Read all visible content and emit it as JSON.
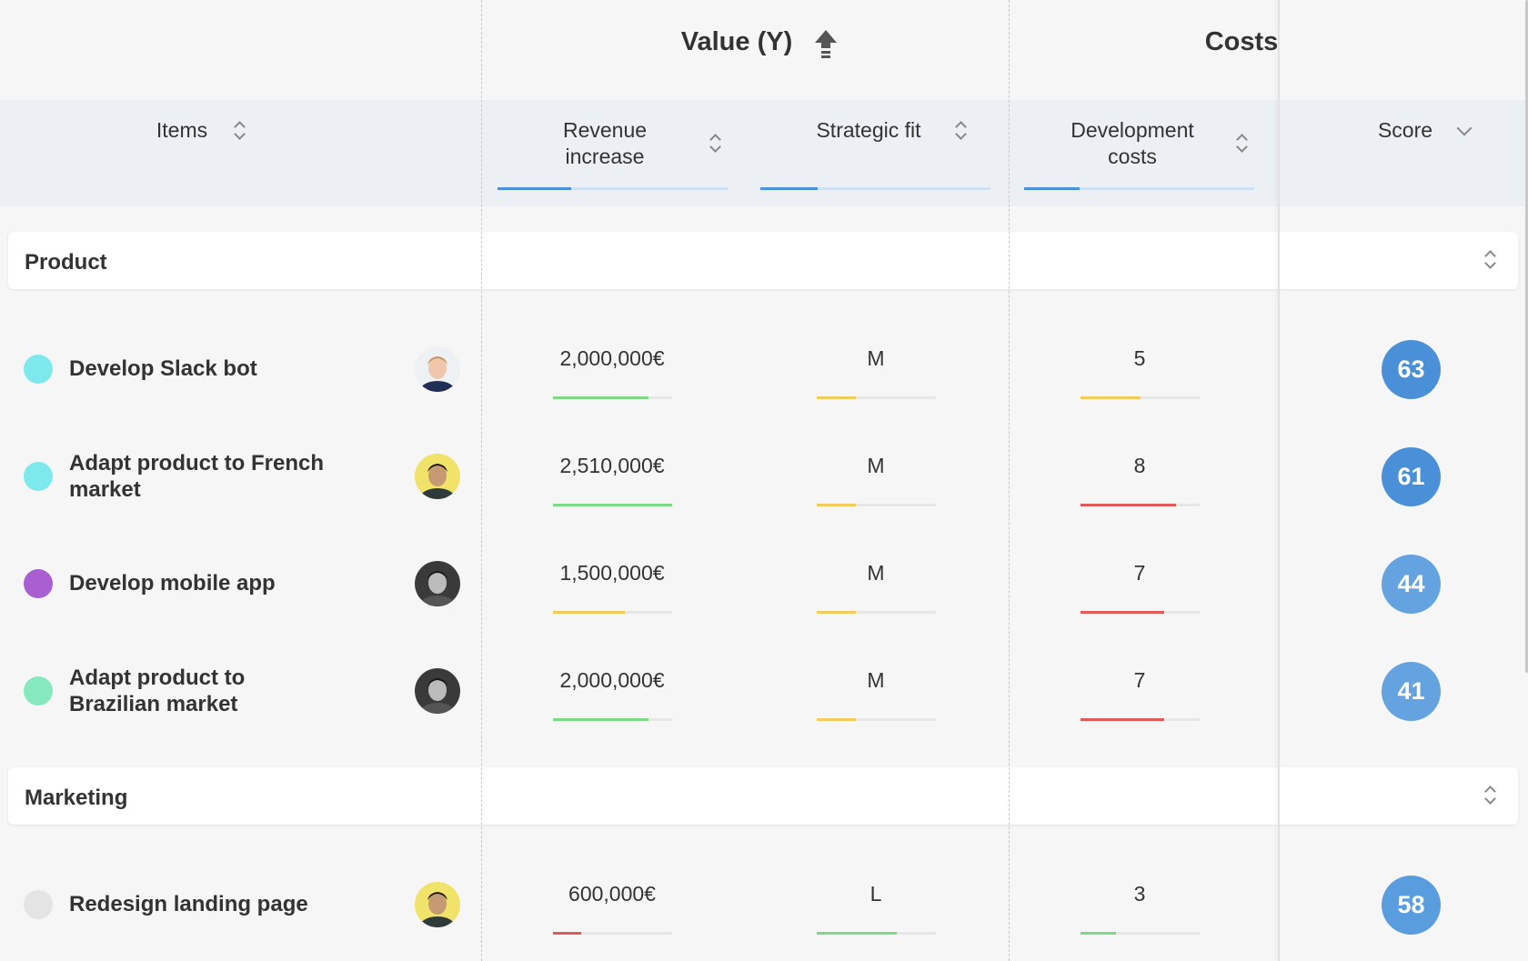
{
  "groups": {
    "value": "Value (Y)",
    "costs": "Costs"
  },
  "columns": {
    "items": "Items",
    "revenue": [
      "Revenue",
      "increase"
    ],
    "strategic": "Strategic fit",
    "dev": [
      "Development",
      "costs"
    ],
    "score": "Score"
  },
  "column_weights": {
    "revenue": 0.32,
    "strategic": 0.25,
    "dev": 0.24
  },
  "sections": [
    {
      "label": "Product",
      "items": [
        {
          "name": [
            "Develop Slack bot"
          ],
          "dot": "#7ee9ec",
          "avatar": "avatar-blond-man-suit",
          "revenue": "2,000,000€",
          "revenue_level": 0.8,
          "revenue_color": "#7ed987",
          "strategic": "M",
          "strategic_level": 0.33,
          "strategic_color": "#f2cc5a",
          "dev": "5",
          "dev_level": 0.5,
          "dev_color": "#f2cc5a",
          "score": "63",
          "score_color": "#4a90d9"
        },
        {
          "name": [
            "Adapt product to French",
            "market"
          ],
          "dot": "#7ee9ec",
          "avatar": "avatar-dark-hair-man-yellow",
          "revenue": "2,510,000€",
          "revenue_level": 1.0,
          "revenue_color": "#7ed987",
          "strategic": "M",
          "strategic_level": 0.33,
          "strategic_color": "#f2cc5a",
          "dev": "8",
          "dev_level": 0.8,
          "dev_color": "#e15b5b",
          "score": "61",
          "score_color": "#4a90d9"
        },
        {
          "name": [
            "Develop mobile app"
          ],
          "dot": "#a95ed1",
          "avatar": "avatar-man-grayscale",
          "revenue": "1,500,000€",
          "revenue_level": 0.6,
          "revenue_color": "#f2cc5a",
          "strategic": "M",
          "strategic_level": 0.33,
          "strategic_color": "#f2cc5a",
          "dev": "7",
          "dev_level": 0.7,
          "dev_color": "#e15b5b",
          "score": "44",
          "score_color": "#64a3e0"
        },
        {
          "name": [
            "Adapt product to",
            "Brazilian market"
          ],
          "dot": "#86e9be",
          "avatar": "avatar-man-grayscale",
          "revenue": "2,000,000€",
          "revenue_level": 0.8,
          "revenue_color": "#7ed987",
          "strategic": "M",
          "strategic_level": 0.33,
          "strategic_color": "#f2cc5a",
          "dev": "7",
          "dev_level": 0.7,
          "dev_color": "#e15b5b",
          "score": "41",
          "score_color": "#64a3e0"
        }
      ]
    },
    {
      "label": "Marketing",
      "items": [
        {
          "name": [
            "Redesign landing page"
          ],
          "dot": "#e4e4e4",
          "avatar": "avatar-dark-hair-man-yellow",
          "revenue": "600,000€",
          "revenue_level": 0.24,
          "revenue_color": "#e15b5b",
          "strategic": "L",
          "strategic_level": 0.67,
          "strategic_color": "#7ed987",
          "dev": "3",
          "dev_level": 0.3,
          "dev_color": "#7ed987",
          "score": "58",
          "score_color": "#5a9ddf"
        }
      ]
    }
  ]
}
